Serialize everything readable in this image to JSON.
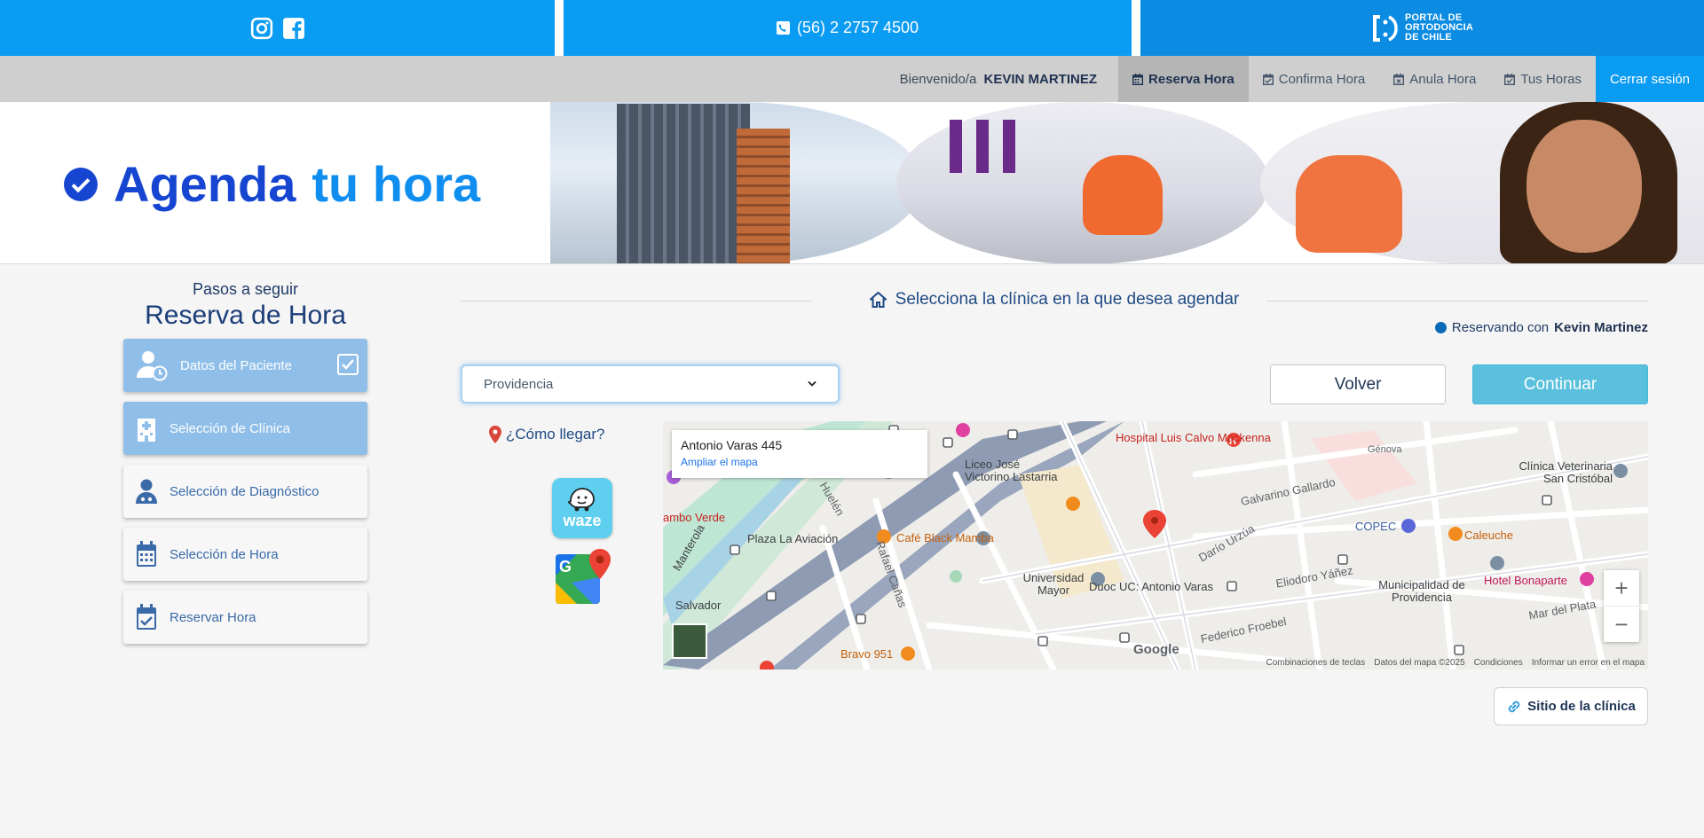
{
  "topbar": {
    "phone": "(56) 2 2757 4500",
    "logo_lines": [
      "PORTAL DE",
      "ORTODONCIA",
      "DE CHILE"
    ],
    "social": [
      "instagram-icon",
      "facebook-icon"
    ]
  },
  "nav": {
    "welcome_prefix": "Bienvenido/a",
    "user_name": "KEVIN MARTINEZ",
    "items": [
      {
        "label": "Reserva Hora",
        "active": true
      },
      {
        "label": "Confirma Hora",
        "active": false
      },
      {
        "label": "Anula Hora",
        "active": false
      },
      {
        "label": "Tus Horas",
        "active": false
      }
    ],
    "logout": "Cerrar sesión"
  },
  "banner": {
    "title_part1": "Agenda",
    "title_part2": "tu hora"
  },
  "steps": {
    "subtitle": "Pasos a seguir",
    "title": "Reserva de Hora",
    "items": [
      {
        "label": "Datos del Paciente",
        "state": "done"
      },
      {
        "label": "Selección de Clínica",
        "state": "current"
      },
      {
        "label": "Selección de Diagnóstico",
        "state": "pending"
      },
      {
        "label": "Selección de Hora",
        "state": "pending"
      },
      {
        "label": "Reservar Hora",
        "state": "pending"
      }
    ]
  },
  "main": {
    "section_title": "Selecciona la clínica en la que desea agendar",
    "reserving_prefix": "Reservando con",
    "reserving_name": "Kevin Martinez",
    "clinic_select_value": "Providencia",
    "volver": "Volver",
    "continuar": "Continuar",
    "how_to_get": "¿Cómo llegar?",
    "waze_label": "waze",
    "site_button": "Sitio de la clínica"
  },
  "map": {
    "info_address": "Antonio Varas 445",
    "info_link": "Ampliar el mapa",
    "labels": {
      "hospital": "Hospital Luis Calvo Mackenna",
      "liceo": "Liceo José Victorino Lastarria",
      "clinica_vet": "Clínica Veterinaria San Cristóbal",
      "plaza": "Plaza La Aviación",
      "cafe": "Café Black Mamba",
      "universidad": "Universidad Mayor",
      "duoc": "Duoc UC: Antonio Varas",
      "copec": "COPEC",
      "caleuche": "Caleuche",
      "municipalidad": "Municipalidad de Providencia",
      "hotel": "Hotel Bonaparte",
      "salvador": "Salvador",
      "bravo": "Bravo 951",
      "galvarino": "Galvarino Gallardo",
      "dario": "Darío Urzúa",
      "eliodoro": "Eliodoro Yáñez",
      "federico": "Federico Froebel",
      "mar_plata": "Mar del Plata",
      "genova": "Génova",
      "rafael": "Rafael Cañas",
      "hueln": "Huelén",
      "ambo": "ambo Verde",
      "manterola": "Manterola"
    },
    "footer": [
      "Combinaciones de teclas",
      "Datos del mapa ©2025",
      "Condiciones",
      "Informar un error en el mapa"
    ],
    "google": "Google"
  },
  "colors": {
    "primary_blue": "#0a9bf2",
    "dark_blue": "#1e3a66",
    "step_done": "#8fbfe8",
    "continue_btn": "#5bc0de"
  }
}
